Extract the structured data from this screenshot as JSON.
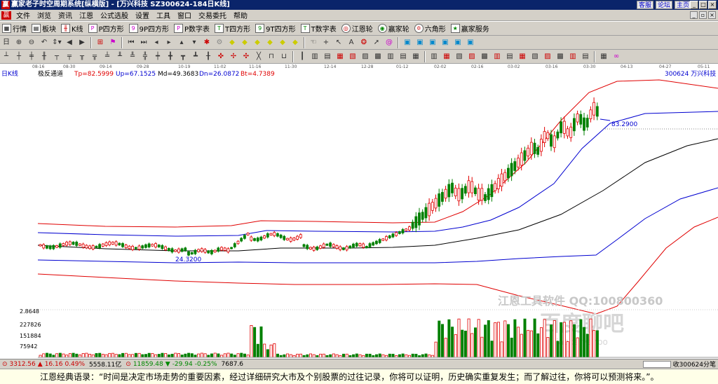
{
  "window": {
    "title": "赢家老子时空周期系统[纵横版] - [万兴科技   SZ300624-184日K线]",
    "links": [
      "客服",
      "论坛",
      "主页"
    ]
  },
  "menu": [
    "文件",
    "浏览",
    "资讯",
    "江恩",
    "公式选股",
    "设置",
    "工具",
    "窗口",
    "交易委托",
    "帮助"
  ],
  "toolbar1": [
    {
      "label": "行情",
      "icon": "grid-icon"
    },
    {
      "label": "板块",
      "icon": "blocks-icon"
    },
    {
      "label": "K线",
      "icon": "kline-icon"
    },
    {
      "label": "P四方形",
      "icon": "p-square-icon"
    },
    {
      "label": "9P四方形",
      "icon": "9p-square-icon"
    },
    {
      "label": "P数字表",
      "icon": "p-number-icon"
    },
    {
      "label": "T四方形",
      "icon": "t-square-icon"
    },
    {
      "label": "9T四方形",
      "icon": "9t-square-icon"
    },
    {
      "label": "T数字表",
      "icon": "t-number-icon"
    },
    {
      "label": "江恩轮",
      "icon": "gann-wheel-icon"
    },
    {
      "label": "赢家轮",
      "icon": "winner-wheel-icon"
    },
    {
      "label": "六角形",
      "icon": "hexagon-icon"
    },
    {
      "label": "赢家服务",
      "icon": "service-icon"
    }
  ],
  "chart": {
    "period_label": "日K线",
    "indicator": "极反通道",
    "tp": "Tp=82.5999",
    "up": "Up=67.1525",
    "md": "Md=49.3683",
    "dn": "Dn=26.0872",
    "bt": "Bt=4.7389",
    "stock": "300624 万兴科技",
    "high_label": "83.2900",
    "low_label": "24.3200",
    "dates": [
      "08-16",
      "08-30",
      "09-14",
      "09-28",
      "10-19",
      "11-02",
      "11-16",
      "11-30",
      "12-14",
      "12-28",
      "01-12",
      "02-02",
      "02-16",
      "03-02",
      "03-16",
      "03-30",
      "04-13",
      "04-27",
      "05-11"
    ],
    "watermark1": "江恩工具软件  QQ:100800360",
    "watermark2": "百度聊吧",
    "watermark3": "liaoba.yahoo",
    "volume_labels": [
      "2.8648",
      "227826",
      "151884",
      "75942"
    ]
  },
  "status": {
    "sh_index": "3312.56",
    "sh_change": "16.16",
    "sh_pct": "0.49%",
    "sh_amount": "5558.11亿",
    "sz_index": "11859.48",
    "sz_change": "-29.94",
    "sz_pct": "-0.25%",
    "sz_amount": "7687.6",
    "receive": "收300624分笔"
  },
  "quote": "江恩经典语录：“时间是决定市场走势的重要因素，经过详细研究大市及个别股票的过往记录，你将可以证明，历史确实重复发生；而了解过往，你将可以预测将来。”。",
  "colors": {
    "red": "#e00000",
    "blue": "#0000d0",
    "green": "#008000",
    "titlebar": "#0a246a"
  }
}
